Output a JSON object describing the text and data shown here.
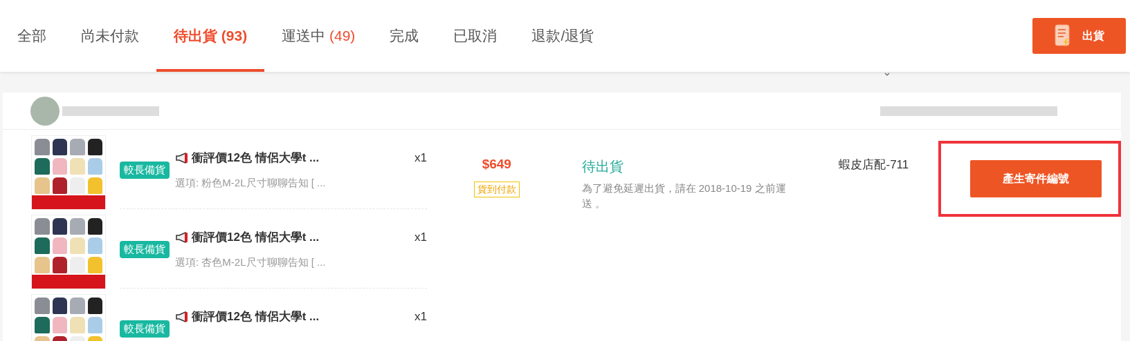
{
  "tabs": [
    {
      "label": "全部",
      "selected": false
    },
    {
      "label": "尚未付款",
      "selected": false
    },
    {
      "label": "待出貨",
      "count": "(93)",
      "selected": true
    },
    {
      "label": "運送中",
      "count": "(49)",
      "selected": false
    },
    {
      "label": "完成",
      "selected": false
    },
    {
      "label": "已取消",
      "selected": false
    },
    {
      "label": "退款/退貨",
      "selected": false
    }
  ],
  "ship_button": {
    "label": "出貨"
  },
  "order": {
    "items": [
      {
        "badge": "較長備貨",
        "title": "衝評價12色 情侶大學t ...",
        "option": "選項: 粉色M-2L尺寸聊聊告知 [ ...",
        "quantity": "x1"
      },
      {
        "badge": "較長備貨",
        "title": "衝評價12色 情侶大學t ...",
        "option": "選項: 杏色M-2L尺寸聊聊告知 [ ...",
        "quantity": "x1"
      },
      {
        "badge": "較長備貨",
        "title": "衝評價12色 情侶大學t ...",
        "quantity": "x1"
      }
    ],
    "price": "$649",
    "payment": "貨到付款",
    "status": "待出貨",
    "status_note": "為了避免延遲出貨，請在 2018-10-19 之前運送 。",
    "logistics": "蝦皮店配-711",
    "action": {
      "label": "產生寄件編號",
      "highlighted": true
    }
  }
}
